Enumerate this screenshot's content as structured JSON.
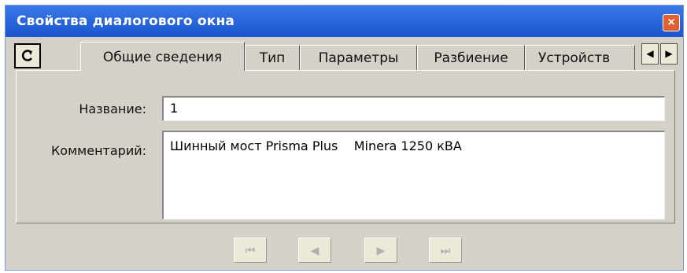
{
  "window": {
    "title": "Свойства диалогового окна",
    "close_label": "×"
  },
  "toolbar": {
    "icon": "refresh-icon"
  },
  "tabs": [
    {
      "label": "Общие сведения",
      "active": true
    },
    {
      "label": "Тип",
      "active": false
    },
    {
      "label": "Параметры",
      "active": false
    },
    {
      "label": "Разбиение",
      "active": false
    },
    {
      "label": "Устройств",
      "active": false
    }
  ],
  "tab_scroll": {
    "prev": "◀",
    "next": "▶"
  },
  "form": {
    "name_label": "Название:",
    "name_value": "1",
    "comment_label": "Комментарий:",
    "comment_value": "Шинный мост Prisma Plus    Minera 1250 кВА"
  },
  "navigation": {
    "first": "⏮",
    "prev": "◀",
    "next": "▶",
    "last": "⏭"
  },
  "colors": {
    "titlebar": "#1b55cf",
    "face": "#d5d1c9",
    "close": "#e06030"
  }
}
